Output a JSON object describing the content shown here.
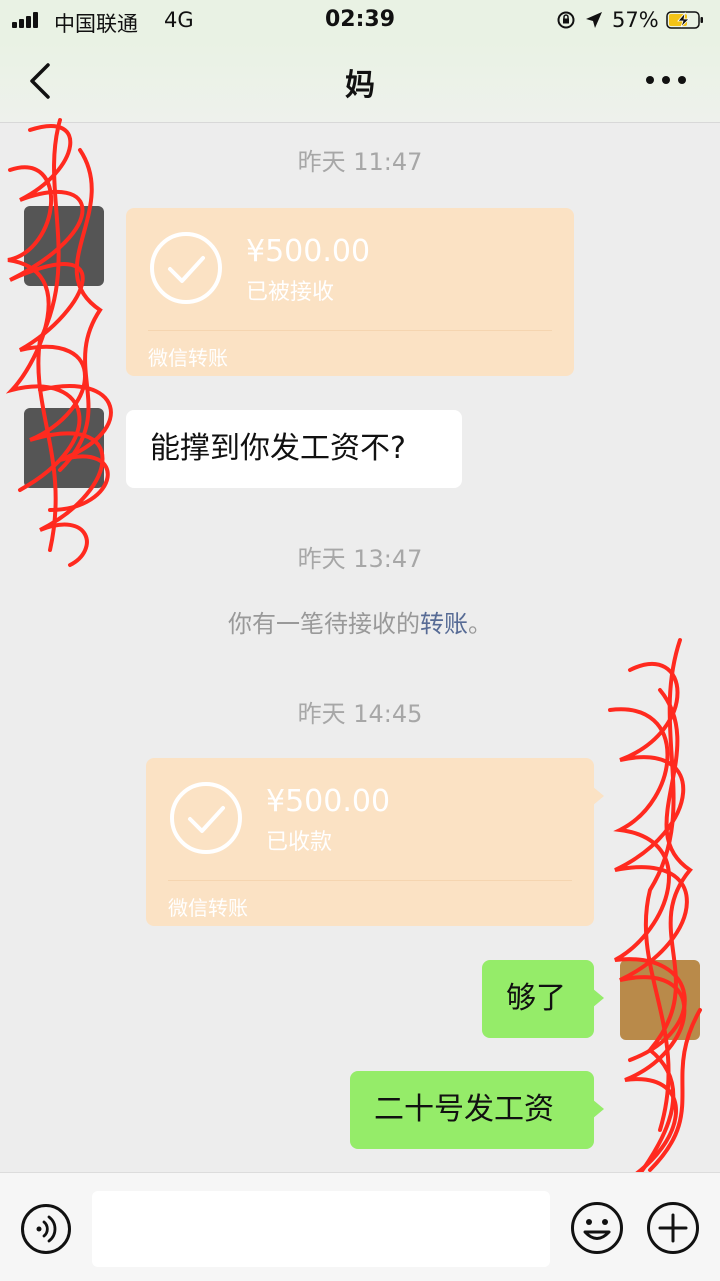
{
  "status_bar": {
    "carrier": "中国联通",
    "network": "4G",
    "time": "02:39",
    "battery_percent": "57%"
  },
  "nav": {
    "title": "妈",
    "back_icon": "chevron-left-icon",
    "more_icon": "more-dots-icon"
  },
  "messages": {
    "ts1": "昨天 11:47",
    "transfer_received": {
      "amount": "¥500.00",
      "status": "已被接收",
      "footer": "微信转账"
    },
    "left_text": "能撑到你发工资不?",
    "ts2": "昨天 13:47",
    "system_notice": {
      "prefix": "你有一笔待接收的",
      "link": "转账",
      "suffix": "。"
    },
    "ts3": "昨天 14:45",
    "transfer_collected": {
      "amount": "¥500.00",
      "status": "已收款",
      "footer": "微信转账"
    },
    "right_text_1": "够了",
    "right_text_2": "二十号发工资"
  },
  "input_bar": {
    "voice_icon": "voice-icon",
    "text_value": "",
    "emoji_icon": "emoji-icon",
    "plus_icon": "plus-icon"
  },
  "colors": {
    "background": "#ededed",
    "green_bubble": "#95ec69",
    "transfer_bubble": "#fbe2c4",
    "link": "#576b95",
    "redaction": "#ff2a1f"
  }
}
